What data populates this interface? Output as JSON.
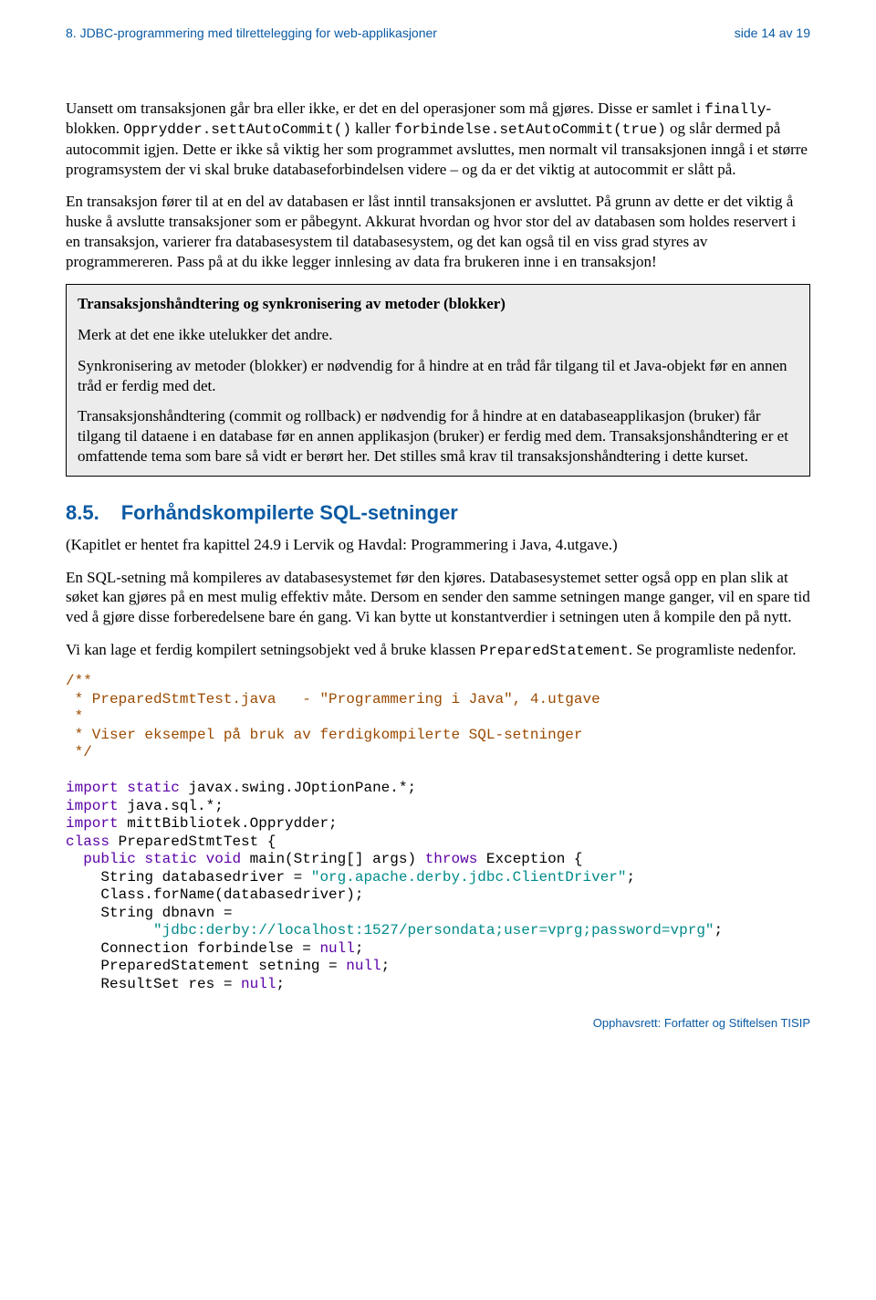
{
  "header": {
    "left": "8. JDBC-programmering med tilrettelegging for web-applikasjoner",
    "right": "side 14 av 19"
  },
  "paragraphs": {
    "p1_a": "Uansett om transaksjonen går bra eller ikke, er det en del operasjoner som må gjøres. Disse er samlet i ",
    "p1_b": "finally",
    "p1_c": "-blokken. ",
    "p1_d": "Opprydder.settAutoCommit()",
    "p1_e": " kaller ",
    "p1_f": "forbindelse.setAutoCommit(true)",
    "p1_g": " og slår dermed på autocommit igjen. Dette er ikke så viktig her som programmet avsluttes, men normalt vil transaksjonen inngå i et større programsystem der vi skal bruke databaseforbindelsen videre – og da er det viktig at autocommit er slått på.",
    "p2": "En transaksjon fører til at en del av databasen er låst inntil transaksjonen er avsluttet. På grunn av dette er det viktig å huske å avslutte transaksjoner som er påbegynt. Akkurat hvordan og hvor stor del av databasen som holdes reservert i en transaksjon, varierer fra databasesystem til databasesystem, og det kan også til en viss grad styres av programmereren. Pass på at du ikke legger innlesing av data fra brukeren inne i en transaksjon!"
  },
  "callout": {
    "title": "Transaksjonshåndtering og synkronisering av metoder (blokker)",
    "c1": "Merk at det ene ikke utelukker det andre.",
    "c2": "Synkronisering av metoder (blokker) er nødvendig for å hindre at en tråd får tilgang til et Java-objekt før en annen tråd er ferdig med det.",
    "c3": "Transaksjonshåndtering (commit og rollback) er nødvendig for å hindre at en databaseapplikasjon (bruker) får tilgang til dataene i en database før en annen applikasjon (bruker) er ferdig med dem. Transaksjonshåndtering er et omfattende tema som bare så vidt er berørt her. Det stilles små krav til transaksjonshåndtering i dette kurset."
  },
  "section": {
    "number": "8.5.",
    "title": "Forhåndskompilerte SQL-setninger",
    "s1": "(Kapitlet er hentet fra kapittel 24.9 i Lervik og Havdal: Programmering i Java, 4.utgave.)",
    "s2": "En SQL-setning må kompileres av databasesystemet før den kjøres. Databasesystemet setter også opp en plan slik at søket kan gjøres på en mest mulig effektiv måte. Dersom en sender den samme setningen mange ganger, vil en spare tid ved å gjøre disse forberedelsene bare én gang. Vi kan bytte ut konstantverdier i setningen uten å kompile den på nytt.",
    "s3_a": "Vi kan lage et ferdig kompilert setningsobjekt ved å bruke klassen ",
    "s3_b": "PreparedStatement",
    "s3_c": ". Se programliste nedenfor."
  },
  "code": {
    "c1": "/**",
    "c2": " * PreparedStmtTest.java   - \"Programmering i Java\", 4.utgave",
    "c3": " *",
    "c4": " * Viser eksempel på bruk av ferdigkompilerte SQL-setninger",
    "c5": " */",
    "l1a": "import",
    "l1b": " ",
    "l1c": "static",
    "l1d": " javax.swing.JOptionPane.*;",
    "l2a": "import",
    "l2b": " java.sql.*;",
    "l3a": "import",
    "l3b": " mittBibliotek.Opprydder;",
    "l4a": "class",
    "l4b": " PreparedStmtTest {",
    "l5a": "  ",
    "l5b": "public",
    "l5c": " ",
    "l5d": "static",
    "l5e": " ",
    "l5f": "void",
    "l5g": " main(String[] args) ",
    "l5h": "throws",
    "l5i": " Exception {",
    "l6a": "    String databasedriver = ",
    "l6b": "\"org.apache.derby.jdbc.ClientDriver\"",
    "l6c": ";",
    "l7a": "    Class.forName(databasedriver);",
    "l8a": "    String dbnavn =",
    "l9a": "          ",
    "l9b": "\"jdbc:derby://localhost:1527/persondata;user=vprg;password=vprg\"",
    "l9c": ";",
    "l10a": "    Connection forbindelse = ",
    "l10b": "null",
    "l10c": ";",
    "l11a": "    PreparedStatement setning = ",
    "l11b": "null",
    "l11c": ";",
    "l12a": "    ResultSet res = ",
    "l12b": "null",
    "l12c": ";"
  },
  "footer": "Opphavsrett:  Forfatter og Stiftelsen TISIP"
}
